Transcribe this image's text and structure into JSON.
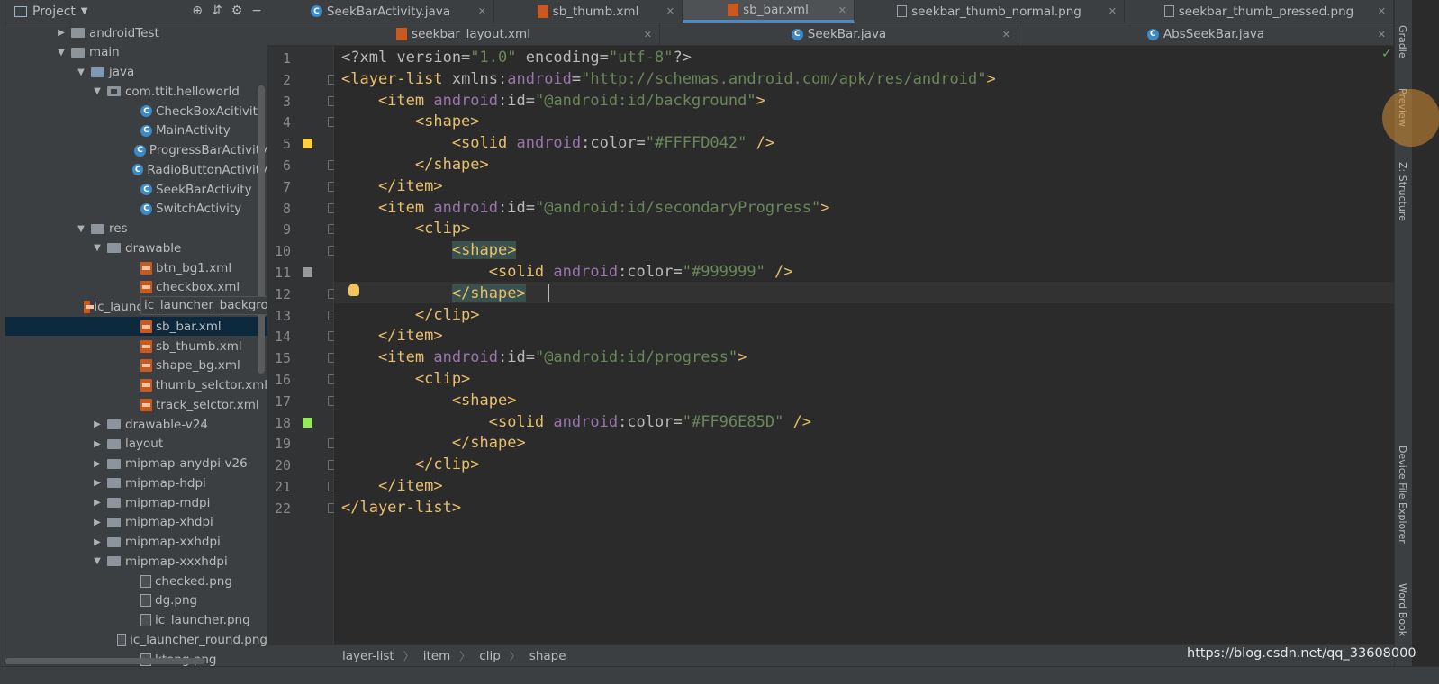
{
  "project_panel": {
    "title": "Project",
    "tree": [
      {
        "label": "androidTest",
        "indent": 1,
        "arrow": "▶",
        "icon": "folder"
      },
      {
        "label": "main",
        "indent": 1,
        "arrow": "▼",
        "icon": "folder"
      },
      {
        "label": "java",
        "indent": 2,
        "arrow": "▼",
        "icon": "folder-java"
      },
      {
        "label": "com.ttit.helloworld",
        "indent": 3,
        "arrow": "▼",
        "icon": "package"
      },
      {
        "label": "CheckBoxAcitivity",
        "indent": 4,
        "arrow": "",
        "icon": "class"
      },
      {
        "label": "MainActivity",
        "indent": 4,
        "arrow": "",
        "icon": "class"
      },
      {
        "label": "ProgressBarActivity",
        "indent": 4,
        "arrow": "",
        "icon": "class"
      },
      {
        "label": "RadioButtonActivity",
        "indent": 4,
        "arrow": "",
        "icon": "class"
      },
      {
        "label": "SeekBarActivity",
        "indent": 4,
        "arrow": "",
        "icon": "class"
      },
      {
        "label": "SwitchActivity",
        "indent": 4,
        "arrow": "",
        "icon": "class"
      },
      {
        "label": "res",
        "indent": 2,
        "arrow": "▼",
        "icon": "folder"
      },
      {
        "label": "drawable",
        "indent": 3,
        "arrow": "▼",
        "icon": "folder"
      },
      {
        "label": "btn_bg1.xml",
        "indent": 4,
        "arrow": "",
        "icon": "xml"
      },
      {
        "label": "checkbox.xml",
        "indent": 4,
        "arrow": "",
        "icon": "xml"
      },
      {
        "label": "ic_launcher_background.xml",
        "indent": 4,
        "arrow": "",
        "icon": "xml"
      },
      {
        "label": "sb_bar.xml",
        "indent": 4,
        "arrow": "",
        "icon": "xml",
        "selected": true
      },
      {
        "label": "sb_thumb.xml",
        "indent": 4,
        "arrow": "",
        "icon": "xml"
      },
      {
        "label": "shape_bg.xml",
        "indent": 4,
        "arrow": "",
        "icon": "xml"
      },
      {
        "label": "thumb_selctor.xml",
        "indent": 4,
        "arrow": "",
        "icon": "xml"
      },
      {
        "label": "track_selctor.xml",
        "indent": 4,
        "arrow": "",
        "icon": "xml"
      },
      {
        "label": "drawable-v24",
        "indent": 3,
        "arrow": "▶",
        "icon": "folder"
      },
      {
        "label": "layout",
        "indent": 3,
        "arrow": "▶",
        "icon": "folder"
      },
      {
        "label": "mipmap-anydpi-v26",
        "indent": 3,
        "arrow": "▶",
        "icon": "folder"
      },
      {
        "label": "mipmap-hdpi",
        "indent": 3,
        "arrow": "▶",
        "icon": "folder"
      },
      {
        "label": "mipmap-mdpi",
        "indent": 3,
        "arrow": "▶",
        "icon": "folder"
      },
      {
        "label": "mipmap-xhdpi",
        "indent": 3,
        "arrow": "▶",
        "icon": "folder"
      },
      {
        "label": "mipmap-xxhdpi",
        "indent": 3,
        "arrow": "▶",
        "icon": "folder"
      },
      {
        "label": "mipmap-xxxhdpi",
        "indent": 3,
        "arrow": "▼",
        "icon": "folder"
      },
      {
        "label": "checked.png",
        "indent": 4,
        "arrow": "",
        "icon": "png"
      },
      {
        "label": "dg.png",
        "indent": 4,
        "arrow": "",
        "icon": "png"
      },
      {
        "label": "ic_launcher.png",
        "indent": 4,
        "arrow": "",
        "icon": "png"
      },
      {
        "label": "ic_launcher_round.png",
        "indent": 4,
        "arrow": "",
        "icon": "png"
      },
      {
        "label": "ktong.png",
        "indent": 4,
        "arrow": "",
        "icon": "png"
      }
    ],
    "tooltip": "ic_launcher_background.xml"
  },
  "tabs_row1": [
    {
      "label": "SeekBarActivity.java",
      "icon": "class-icon",
      "active": false
    },
    {
      "label": "sb_thumb.xml",
      "icon": "xml-icon",
      "active": false
    },
    {
      "label": "sb_bar.xml",
      "icon": "xml-icon",
      "active": true
    },
    {
      "label": "seekbar_thumb_normal.png",
      "icon": "png-icon",
      "active": false
    },
    {
      "label": "seekbar_thumb_pressed.png",
      "icon": "png-icon",
      "active": false
    }
  ],
  "tabs_row2": [
    {
      "label": "seekbar_layout.xml",
      "icon": "xml-icon",
      "active": false
    },
    {
      "label": "SeekBar.java",
      "icon": "class-icon",
      "active": false
    },
    {
      "label": "AbsSeekBar.java",
      "icon": "class-icon",
      "active": false
    }
  ],
  "editor": {
    "line_numbers": [
      "1",
      "2",
      "3",
      "4",
      "5",
      "6",
      "7",
      "8",
      "9",
      "10",
      "11",
      "12",
      "13",
      "14",
      "15",
      "16",
      "17",
      "18",
      "19",
      "20",
      "21",
      "22"
    ],
    "lines": [
      [
        {
          "t": "<?xml version=",
          "c": "attr"
        },
        {
          "t": "\"1.0\"",
          "c": "val"
        },
        {
          "t": " encoding=",
          "c": "attr"
        },
        {
          "t": "\"utf-8\"",
          "c": "val"
        },
        {
          "t": "?>",
          "c": "attr"
        }
      ],
      [
        {
          "t": "<layer-list ",
          "c": "tag"
        },
        {
          "t": "xmlns:",
          "c": "attr"
        },
        {
          "t": "android",
          "c": "ns"
        },
        {
          "t": "=",
          "c": "attr"
        },
        {
          "t": "\"http://schemas.android.com/apk/res/android\"",
          "c": "val"
        },
        {
          "t": ">",
          "c": "tag"
        }
      ],
      [
        {
          "t": "    <item ",
          "c": "tag"
        },
        {
          "t": "android",
          "c": "ns"
        },
        {
          "t": ":id=",
          "c": "attr"
        },
        {
          "t": "\"@android:id/background\"",
          "c": "val"
        },
        {
          "t": ">",
          "c": "tag"
        }
      ],
      [
        {
          "t": "        <shape>",
          "c": "tag"
        }
      ],
      [
        {
          "t": "            <solid ",
          "c": "tag"
        },
        {
          "t": "android",
          "c": "ns"
        },
        {
          "t": ":color=",
          "c": "attr"
        },
        {
          "t": "\"#FFFFD042\"",
          "c": "val"
        },
        {
          "t": " />",
          "c": "tag"
        }
      ],
      [
        {
          "t": "        </shape>",
          "c": "tag"
        }
      ],
      [
        {
          "t": "    </item>",
          "c": "tag"
        }
      ],
      [
        {
          "t": "    <item ",
          "c": "tag"
        },
        {
          "t": "android",
          "c": "ns"
        },
        {
          "t": ":id=",
          "c": "attr"
        },
        {
          "t": "\"@android:id/secondaryProgress\"",
          "c": "val"
        },
        {
          "t": ">",
          "c": "tag"
        }
      ],
      [
        {
          "t": "        <clip>",
          "c": "tag"
        }
      ],
      [
        {
          "t": "            ",
          "c": "tag"
        },
        {
          "t": "<shape>",
          "c": "tag",
          "hl": true
        }
      ],
      [
        {
          "t": "                <solid ",
          "c": "tag"
        },
        {
          "t": "android",
          "c": "ns"
        },
        {
          "t": ":color=",
          "c": "attr"
        },
        {
          "t": "\"#999999\"",
          "c": "val"
        },
        {
          "t": " />",
          "c": "tag"
        }
      ],
      [
        {
          "t": "            ",
          "c": "tag"
        },
        {
          "t": "</shape>",
          "c": "tag",
          "hl": true
        }
      ],
      [
        {
          "t": "        </clip>",
          "c": "tag"
        }
      ],
      [
        {
          "t": "    </item>",
          "c": "tag"
        }
      ],
      [
        {
          "t": "    <item ",
          "c": "tag"
        },
        {
          "t": "android",
          "c": "ns"
        },
        {
          "t": ":id=",
          "c": "attr"
        },
        {
          "t": "\"@android:id/progress\"",
          "c": "val"
        },
        {
          "t": ">",
          "c": "tag"
        }
      ],
      [
        {
          "t": "        <clip>",
          "c": "tag"
        }
      ],
      [
        {
          "t": "            <shape>",
          "c": "tag"
        }
      ],
      [
        {
          "t": "                <solid ",
          "c": "tag"
        },
        {
          "t": "android",
          "c": "ns"
        },
        {
          "t": ":color=",
          "c": "attr"
        },
        {
          "t": "\"#FF96E85D\"",
          "c": "val"
        },
        {
          "t": " />",
          "c": "tag"
        }
      ],
      [
        {
          "t": "            </shape>",
          "c": "tag"
        }
      ],
      [
        {
          "t": "        </clip>",
          "c": "tag"
        }
      ],
      [
        {
          "t": "    </item>",
          "c": "tag"
        }
      ],
      [
        {
          "t": "</layer-list>",
          "c": "tag"
        }
      ]
    ],
    "swatches": [
      {
        "line": 5,
        "color": "#FFD042"
      },
      {
        "line": 11,
        "color": "#999999"
      },
      {
        "line": 18,
        "color": "#96E85D"
      }
    ]
  },
  "breadcrumb": [
    "layer-list",
    "item",
    "clip",
    "shape"
  ],
  "right_strip": [
    "Gradle",
    "Preview",
    "Z: Structure",
    "Device File Explorer",
    "Word Book"
  ],
  "watermark": "https://blog.csdn.net/qq_33608000"
}
